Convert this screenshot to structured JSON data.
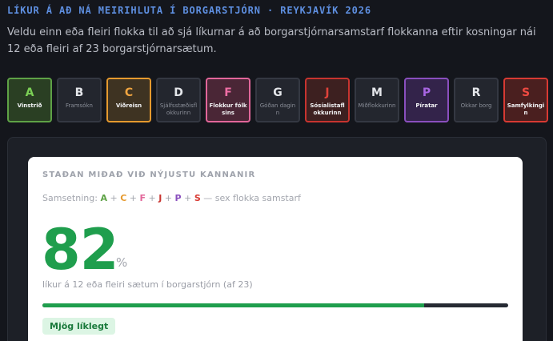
{
  "header": {
    "title": "LÍKUR Á AÐ NÁ MEIRIHLUTA Í BORGARSTJÓRN · REYKJAVÍK 2026",
    "description": "Veldu einn eða fleiri flokka til að sjá líkurnar á að borgarstjórnarsamstarf flokkanna eftir kosningar nái 12 eða fleiri af 23 borgarstjórnarsætum."
  },
  "parties": [
    {
      "letter": "A",
      "name": "Vinstrið",
      "selected": true
    },
    {
      "letter": "B",
      "name": "Framsókn",
      "selected": false
    },
    {
      "letter": "C",
      "name": "Viðreisn",
      "selected": true
    },
    {
      "letter": "D",
      "name": "Sjálfsstæðisflokkurinn",
      "selected": false
    },
    {
      "letter": "F",
      "name": "Flokkur fólksins",
      "selected": true
    },
    {
      "letter": "G",
      "name": "Góðan daginn",
      "selected": false
    },
    {
      "letter": "J",
      "name": "Sósíalistaflokkurinn",
      "selected": true
    },
    {
      "letter": "M",
      "name": "Miðflokkurinn",
      "selected": false
    },
    {
      "letter": "P",
      "name": "Píratar",
      "selected": true
    },
    {
      "letter": "R",
      "name": "Okkar borg",
      "selected": false
    },
    {
      "letter": "S",
      "name": "Samfylkingin",
      "selected": true
    }
  ],
  "result": {
    "heading": "STAÐAN MIÐAÐ VIÐ NÝJUSTU KANNANIR",
    "combo_label": "Samsetning:",
    "combo_parties": [
      "A",
      "C",
      "F",
      "J",
      "P",
      "S"
    ],
    "combo_colors": {
      "A": "#5ea246",
      "C": "#e69a2e",
      "F": "#e2669a",
      "J": "#c8342f",
      "P": "#8a4fbe",
      "S": "#d83a33"
    },
    "combo_suffix": "— sex flokka samstarf",
    "probability": "82",
    "percent_sign": "%",
    "probability_fraction": 0.82,
    "subtitle": "líkur á 12 eða fleiri sætum í borgarstjórn (af 23)",
    "badge": "Mjög líklegt",
    "accent_color": "#1f9e4d"
  }
}
